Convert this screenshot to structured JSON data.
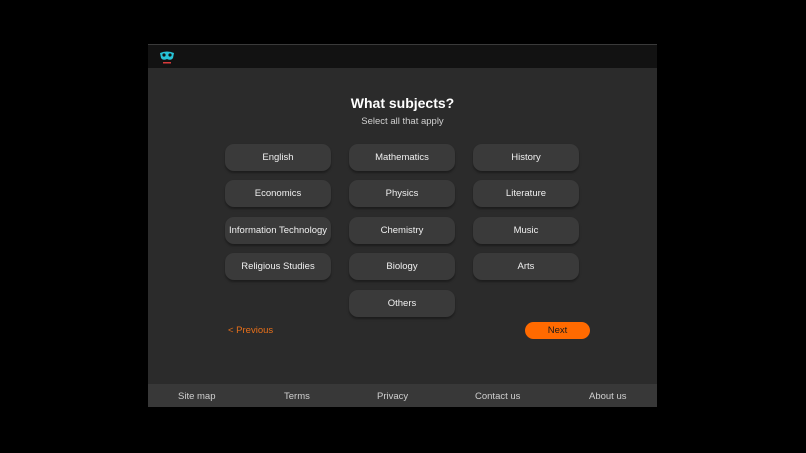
{
  "brand": {
    "logo_icon": "mask-logo-icon",
    "accent": "#ff6a00"
  },
  "page": {
    "title": "What subjects?",
    "subtitle": "Select all that apply"
  },
  "subjects": [
    "English",
    "Mathematics",
    "History",
    "Economics",
    "Physics",
    "Literature",
    "Information Technology",
    "Chemistry",
    "Music",
    "Religious Studies",
    "Biology",
    "Arts",
    "Others"
  ],
  "nav": {
    "previous": "< Previous",
    "next": "Next"
  },
  "footer": {
    "links": [
      "Site map",
      "Terms",
      "Privacy",
      "Contact us",
      "About us"
    ]
  }
}
